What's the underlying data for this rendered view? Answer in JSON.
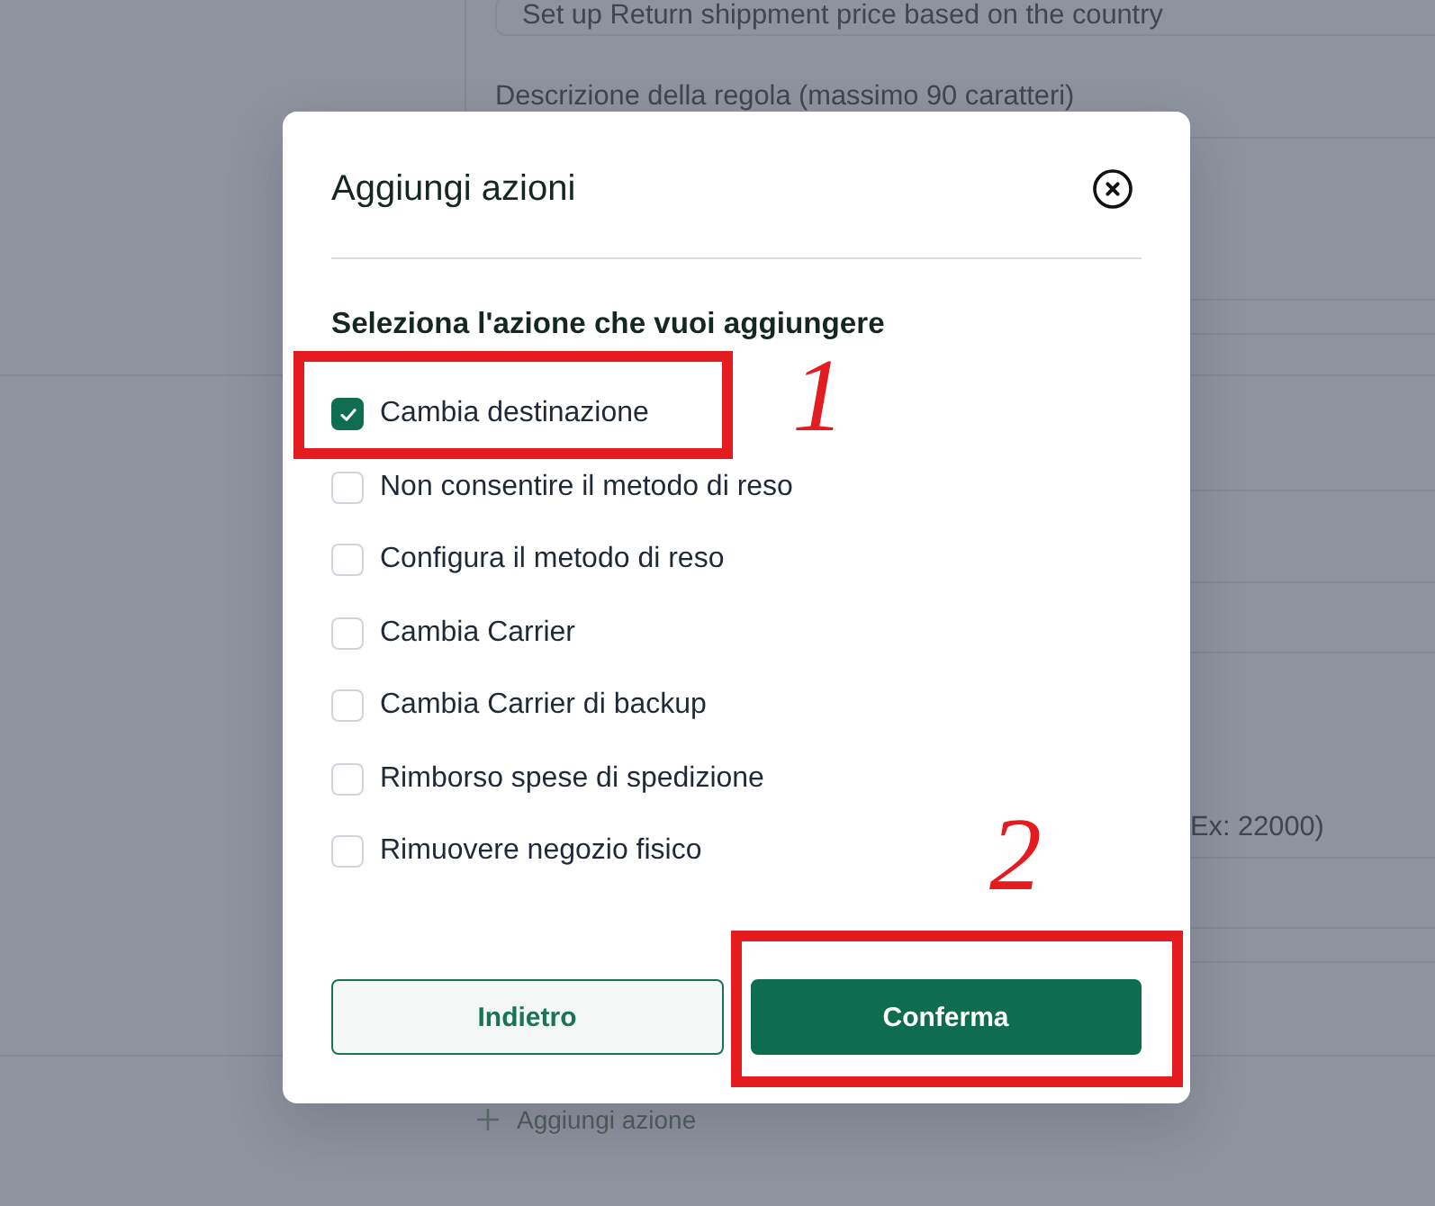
{
  "background": {
    "rule_name": "Set up Return shippment price based on the country",
    "description_label": "Descrizione della regola (massimo 90 caratteri)",
    "amount_hint": "Ex: 22000)",
    "add_action": "Aggiungi azione"
  },
  "dialog": {
    "title": "Aggiungi azioni",
    "prompt": "Seleziona l'azione che vuoi aggiungere",
    "options": [
      {
        "label": "Cambia destinazione",
        "checked": true,
        "annotation": "1"
      },
      {
        "label": "Non consentire il metodo di reso",
        "checked": false
      },
      {
        "label": "Configura il metodo di reso",
        "checked": false
      },
      {
        "label": "Cambia Carrier",
        "checked": false
      },
      {
        "label": "Cambia Carrier di backup",
        "checked": false
      },
      {
        "label": "Rimborso spese di spedizione",
        "checked": false
      },
      {
        "label": "Rimuovere negozio fisico",
        "checked": false
      }
    ],
    "buttons": [
      {
        "label": "Indietro",
        "kind": "secondary"
      },
      {
        "label": "Conferma",
        "kind": "primary",
        "annotation": "2"
      }
    ]
  }
}
